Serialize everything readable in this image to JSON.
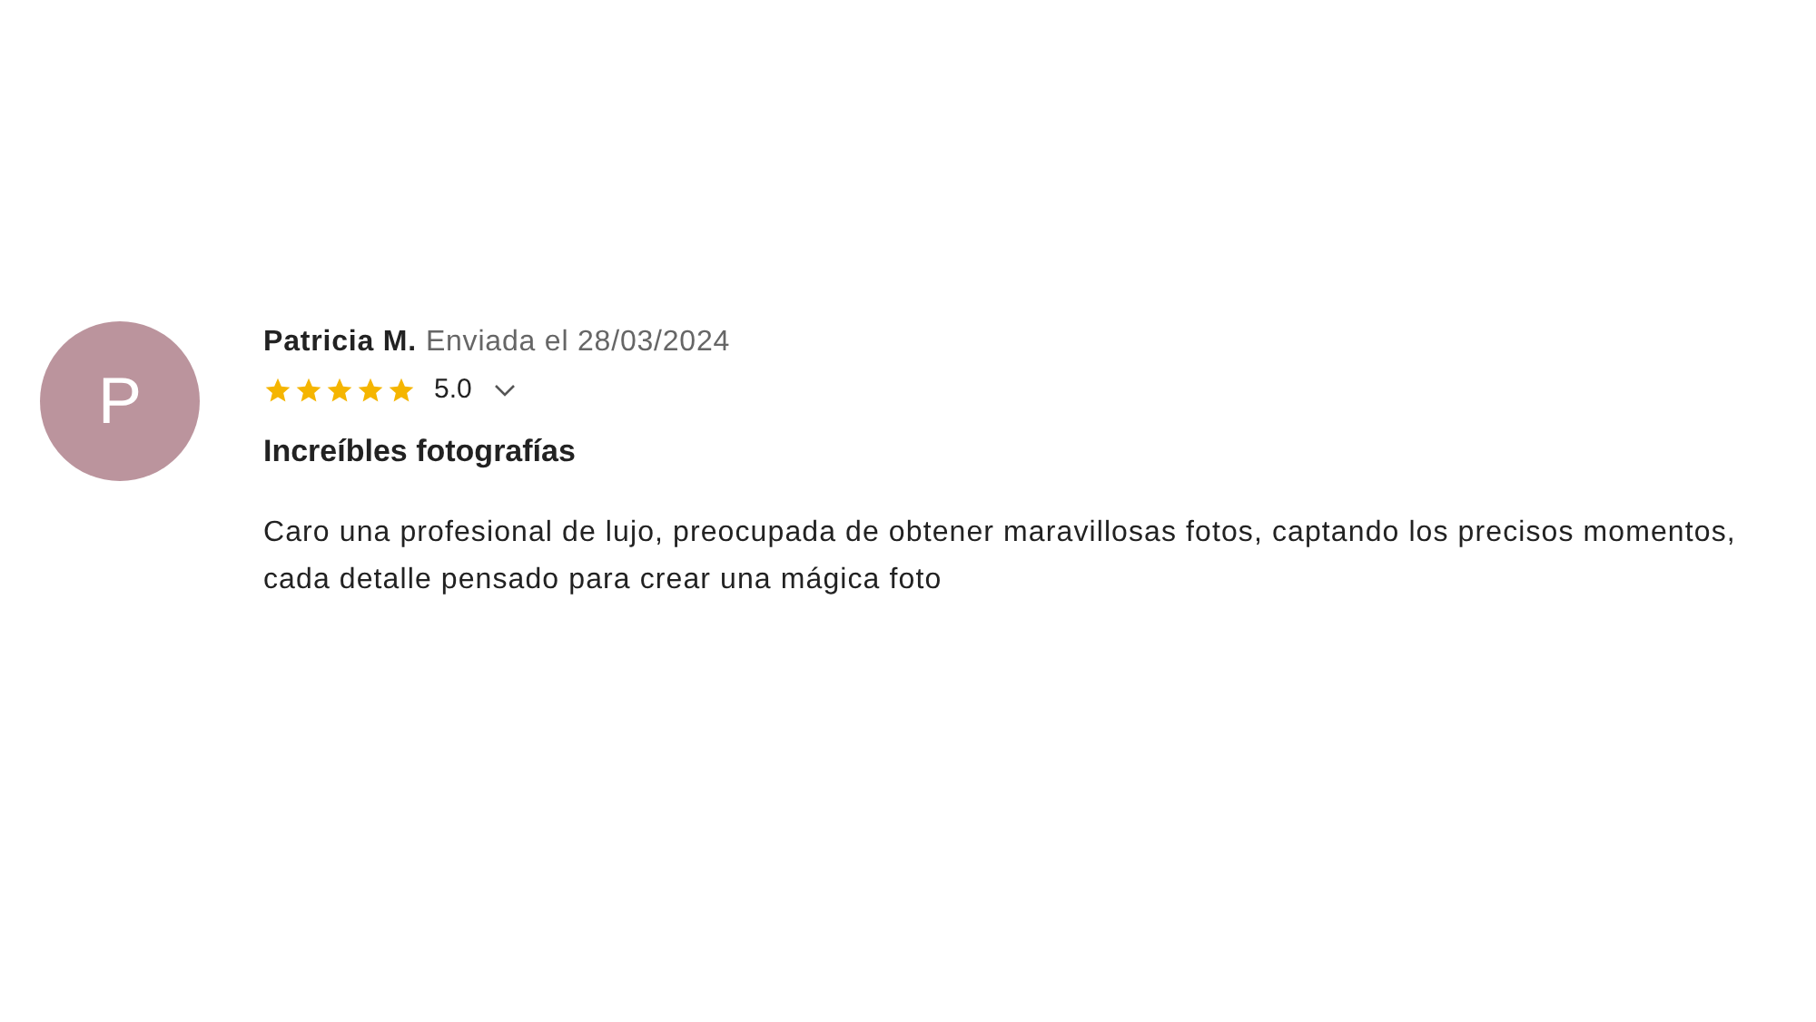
{
  "review": {
    "avatar_letter": "P",
    "author": "Patricia M.",
    "date": "Enviada el 28/03/2024",
    "stars": 5,
    "rating": "5.0",
    "title": "Increíbles fotografías",
    "body": "Caro una profesional de lujo, preocupada de obtener maravillosas fotos, captando los precisos momentos, cada detalle pensado para crear una mágica foto"
  }
}
